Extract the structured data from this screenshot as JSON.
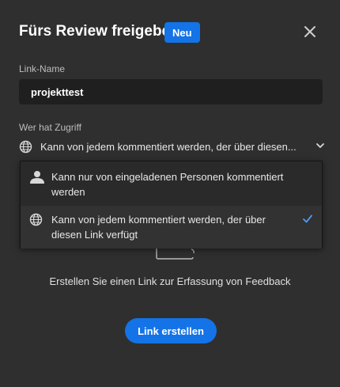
{
  "dialog": {
    "title": "Fürs Review freigeben",
    "badge": "Neu",
    "top_hint": "“"
  },
  "link_name": {
    "label": "Link-Name",
    "value": "projekttest"
  },
  "access": {
    "label": "Wer hat Zugriff",
    "selected_text": "Kann von jedem kommentiert werden, der über diesen...",
    "options": [
      {
        "label": "Kann nur von eingeladenen Personen kommentiert werden",
        "icon": "person-icon",
        "selected": false
      },
      {
        "label": "Kann von jedem kommentiert werden, der über diesen Link verfügt",
        "icon": "globe-icon",
        "selected": true
      }
    ]
  },
  "empty_state": {
    "description": "Erstellen Sie einen Link zur Erfassung von Feedback"
  },
  "actions": {
    "create_link": "Link erstellen"
  },
  "colors": {
    "accent": "#1473e6",
    "background": "#2f2f2f",
    "input_bg": "#1f1f1f"
  }
}
